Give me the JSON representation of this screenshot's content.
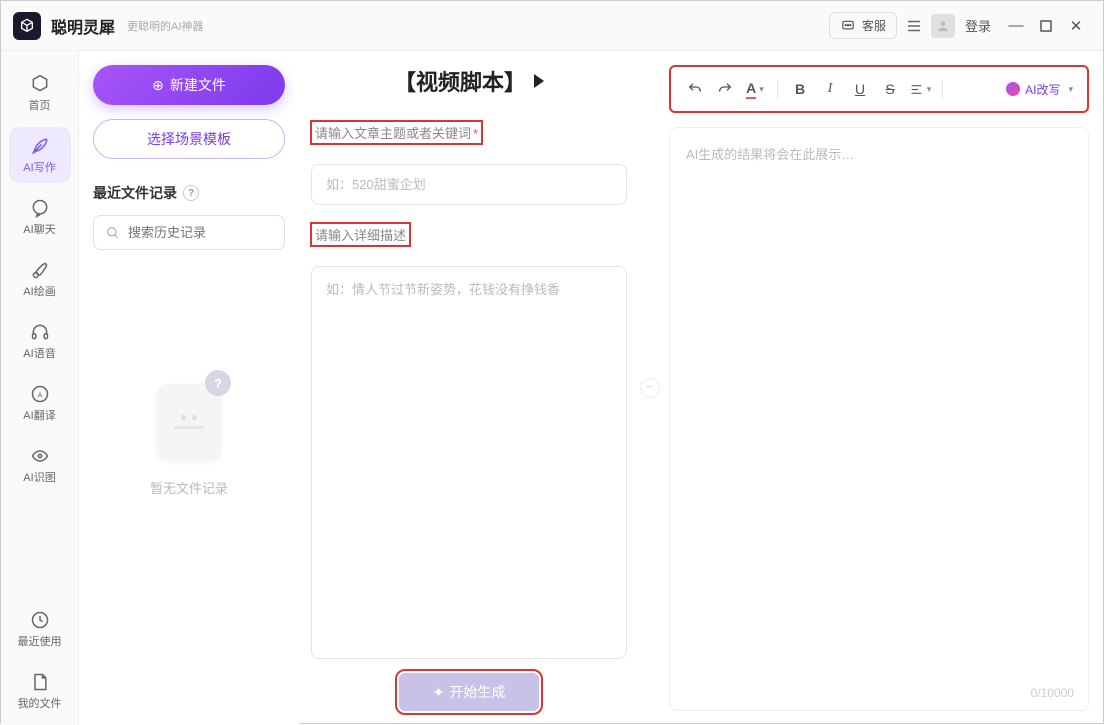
{
  "titlebar": {
    "app_name": "聪明灵犀",
    "subtitle": "更聪明的AI神器",
    "support": "客服",
    "login": "登录"
  },
  "sidebar": {
    "items": [
      {
        "label": "首页"
      },
      {
        "label": "AI写作"
      },
      {
        "label": "AI聊天"
      },
      {
        "label": "AI绘画"
      },
      {
        "label": "AI语音"
      },
      {
        "label": "AI翻译"
      },
      {
        "label": "AI识图"
      },
      {
        "label": "最近使用"
      },
      {
        "label": "我的文件"
      }
    ]
  },
  "left": {
    "new_file": "新建文件",
    "choose_template": "选择场景模板",
    "recent_header": "最近文件记录",
    "search_placeholder": "搜索历史记录",
    "empty_text": "暂无文件记录"
  },
  "mid": {
    "title": "【视频脚本】",
    "topic_label": "请输入文章主题或者关键词",
    "topic_placeholder": "如：520甜蜜企划",
    "detail_label": "请输入详细描述",
    "detail_placeholder": "如：情人节过节新姿势，花钱没有挣钱香",
    "generate": "开始生成"
  },
  "right": {
    "ai_rewrite": "AI改写",
    "output_placeholder": "AI生成的结果将会在此展示…",
    "char_count": "0/10000"
  }
}
